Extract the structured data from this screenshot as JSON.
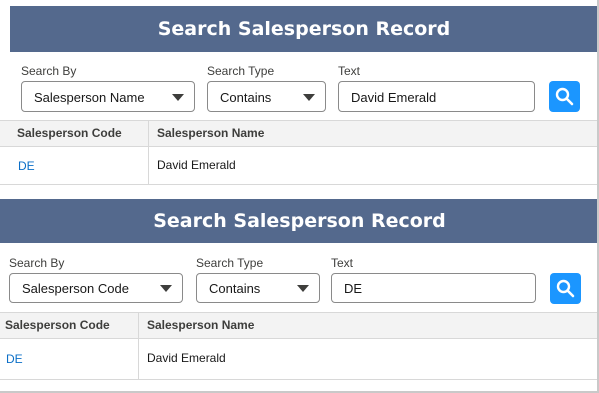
{
  "panels": [
    {
      "title": "Search Salesperson Record",
      "search_by_label": "Search By",
      "search_by_value": "Salesperson Name",
      "search_type_label": "Search Type",
      "search_type_value": "Contains",
      "text_label": "Text",
      "text_value": "David Emerald",
      "columns": [
        "Salesperson Code",
        "Salesperson Name"
      ],
      "rows": [
        {
          "code": "DE",
          "name": "David Emerald"
        }
      ]
    },
    {
      "title": "Search Salesperson Record",
      "search_by_label": "Search By",
      "search_by_value": "Salesperson Code",
      "search_type_label": "Search Type",
      "search_type_value": "Contains",
      "text_label": "Text",
      "text_value": "DE",
      "columns": [
        "Salesperson Code",
        "Salesperson Name"
      ],
      "rows": [
        {
          "code": "DE",
          "name": "David Emerald"
        }
      ]
    }
  ],
  "colors": {
    "header_bg": "#54698d",
    "search_button": "#1b96ff",
    "link": "#0b6fc7"
  },
  "icons": {
    "search_button_icon": "search-icon",
    "dropdown_icon": "chevron-down-icon"
  }
}
